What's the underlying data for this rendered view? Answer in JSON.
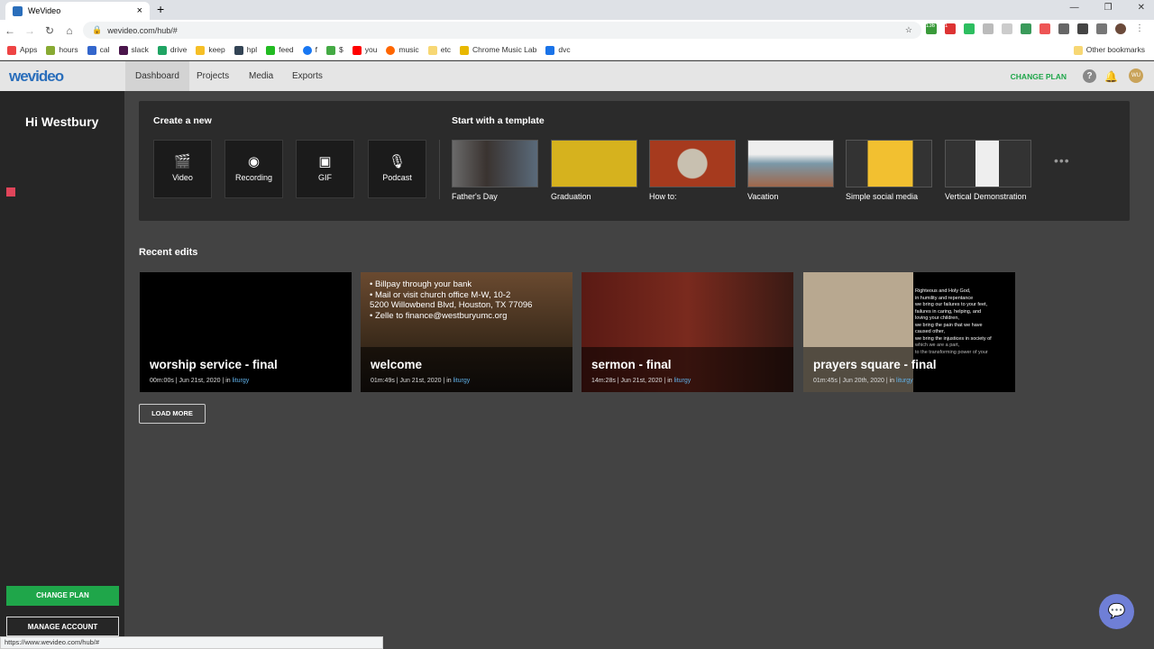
{
  "browser": {
    "tab_title": "WeVideo",
    "url": "wevideo.com/hub/#",
    "status_url": "https://www.wevideo.com/hub/#",
    "bookmarks": [
      "Apps",
      "hours",
      "cal",
      "slack",
      "drive",
      "keep",
      "hpl",
      "feed",
      "f",
      "$",
      "you",
      "music",
      "etc",
      "Chrome Music Lab",
      "dvc"
    ],
    "other_bookmarks": "Other bookmarks",
    "ext_badges": [
      "136",
      "1"
    ]
  },
  "app": {
    "logo": "wevideo",
    "nav": [
      "Dashboard",
      "Projects",
      "Media",
      "Exports"
    ],
    "active_nav": "Dashboard",
    "change_plan": "CHANGE PLAN",
    "avatar_initials": "WU",
    "accent": "#1fa64a"
  },
  "sidebar": {
    "greeting": "Hi Westbury",
    "change_plan": "CHANGE PLAN",
    "manage_account": "MANAGE ACCOUNT"
  },
  "create": {
    "heading": "Create a new",
    "items": [
      {
        "label": "Video",
        "icon": "clapperboard-icon"
      },
      {
        "label": "Recording",
        "icon": "record-icon"
      },
      {
        "label": "GIF",
        "icon": "gif-icon"
      },
      {
        "label": "Podcast",
        "icon": "microphone-icon"
      }
    ]
  },
  "templates": {
    "heading": "Start with a template",
    "items": [
      "Father's Day",
      "Graduation",
      "How to:",
      "Vacation",
      "Simple social media",
      "Vertical Demonstration"
    ]
  },
  "recent": {
    "heading": "Recent edits",
    "load_more": "LOAD MORE",
    "items": [
      {
        "title": "worship service - final",
        "meta": "00m:00s | Jun 21st, 2020 | in ",
        "folder": "liturgy"
      },
      {
        "title": "welcome",
        "meta": "01m:49s | Jun 21st, 2020 | in ",
        "folder": "liturgy",
        "overlay": [
          "• Billpay through your bank",
          "• Mail or visit church office M-W, 10-2",
          "5200 Willowbend Blvd, Houston, TX 77096",
          "• Zelle to finance@westburyumc.org"
        ]
      },
      {
        "title": "sermon - final",
        "meta": "14m:28s | Jun 21st, 2020 | in ",
        "folder": "liturgy"
      },
      {
        "title": "prayers square - final",
        "meta": "01m:45s | Jun 20th, 2020 | in ",
        "folder": "liturgy",
        "overlay": [
          "Righteous and Holy God,",
          "in humility and repentance",
          "we bring our failures to your feet,",
          "failures in caring, helping, and",
          "loving your children,",
          "we bring the pain that we have",
          "caused other,",
          "we bring the injustices in society of",
          "which we are a part,",
          "to the transforming power of your"
        ]
      }
    ]
  }
}
